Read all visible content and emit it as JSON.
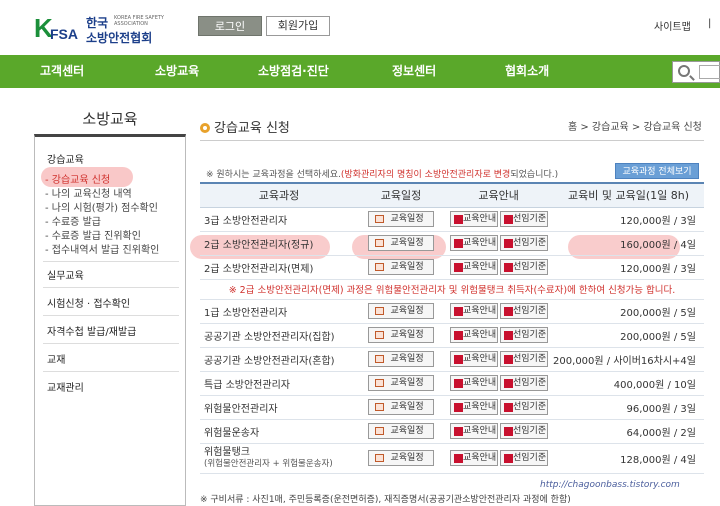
{
  "header": {
    "logo_k": "K",
    "logo_fsa": "FSA",
    "logo_kor_line1": "한국",
    "logo_eng": "KOREA FIRE SAFETY ASSOCIATION",
    "logo_kor_line2": "소방안전협회",
    "login_label": "로그인",
    "join_label": "회원가입",
    "sitemap_label": "사이트맵",
    "sitemap_extra": "|"
  },
  "nav": {
    "items": [
      "고객센터",
      "소방교육",
      "소방점검·진단",
      "정보센터",
      "협회소개"
    ]
  },
  "sidebar": {
    "title": "소방교육",
    "sections": [
      {
        "label": "강습교육"
      },
      {
        "label": "실무교육"
      },
      {
        "label": "시험신청 · 접수확인"
      },
      {
        "label": "자격수첩 발급/재발급"
      },
      {
        "label": "교재"
      },
      {
        "label": "교재관리"
      }
    ],
    "sub_items": [
      "- 강습교육 신청",
      "- 나의 교육신청 내역",
      "- 나의 시험(평가) 점수확인",
      "- 수료증 발급",
      "- 수료증 발급 진위확인",
      "- 접수내역서 발급 진위확인"
    ]
  },
  "main": {
    "title": "강습교육 신청",
    "breadcrumb": "홈 > 강습교육 > 강습교육 신청",
    "notice_prefix": "※ 원하시는 교육과정을 선택하세요.",
    "notice_red": "(방화관리자의 명칭이 소방안전관리자로 변경",
    "notice_suffix": "되었습니다.)",
    "all_courses_button": "교육과정 전체보기",
    "table": {
      "headers": [
        "교육과정",
        "교육일정",
        "교육안내",
        "교육비 및 교육일(1일 8h)"
      ],
      "schedule_label": "교육일정",
      "guide_label": "교육안내",
      "criteria_label": "선임기준",
      "rows": [
        {
          "course": "3급 소방안전관리자",
          "fee": "120,000원 / 3일"
        },
        {
          "course": "2급 소방안전관리자(정규)",
          "fee": "160,000원 / 4일"
        },
        {
          "course": "2급 소방안전관리자(면제)",
          "fee": "120,000원 / 3일"
        },
        {
          "course": "1급 소방안전관리자",
          "fee": "200,000원 / 5일"
        },
        {
          "course": "공공기관 소방안전관리자(집합)",
          "fee": "200,000원 / 5일"
        },
        {
          "course": "공공기관 소방안전관리자(혼합)",
          "fee": "200,000원 / 사이버16차시+4일"
        },
        {
          "course": "특급 소방안전관리자",
          "fee": "400,000원 / 10일"
        },
        {
          "course": "위험물안전관리자",
          "fee": "96,000원 / 3일"
        },
        {
          "course": "위험물운송자",
          "fee": "64,000원 / 2일"
        },
        {
          "course": "위험물탱크",
          "course_sub": "(위험물안전관리자 + 위험물운송자)",
          "fee": "128,000원 / 4일"
        }
      ],
      "middle_notice": "※ 2급 소방안전관리자(면제) 과정은 위험물안전관리자 및 위험물탱크 취득자(수료자)에 한하여 신청가능 합니다."
    },
    "footnote": "※ 구비서류 : 사진1매, 주민등록증(운전면허증), 재직증명서(공공기관소방안전관리자 과정에 한함)",
    "watermark": "http://chagoonbass.tistory.com"
  },
  "colors": {
    "nav_green": "#5aa82a",
    "highlight": "#f7b6b6",
    "accent_red": "#d0312d"
  }
}
